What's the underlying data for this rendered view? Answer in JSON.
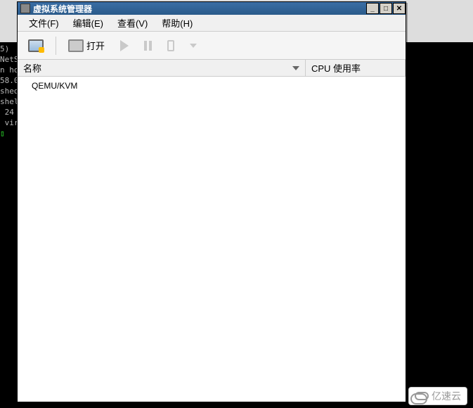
{
  "terminal": {
    "lines": [
      "5)",
      "NetS",
      "",
      "n hot",
      "",
      "58.0",
      "shed.",
      "shel",
      "",
      " 24",
      " vir"
    ],
    "prompt": "▯"
  },
  "window": {
    "title": "虚拟系统管理器"
  },
  "menu": {
    "file": "文件(F)",
    "edit": "编辑(E)",
    "view": "查看(V)",
    "help": "帮助(H)"
  },
  "toolbar": {
    "open_label": "打开"
  },
  "columns": {
    "name": "名称",
    "cpu": "CPU 使用率"
  },
  "list": {
    "items": [
      {
        "name": "QEMU/KVM"
      }
    ]
  },
  "watermark": {
    "text": "亿速云"
  }
}
